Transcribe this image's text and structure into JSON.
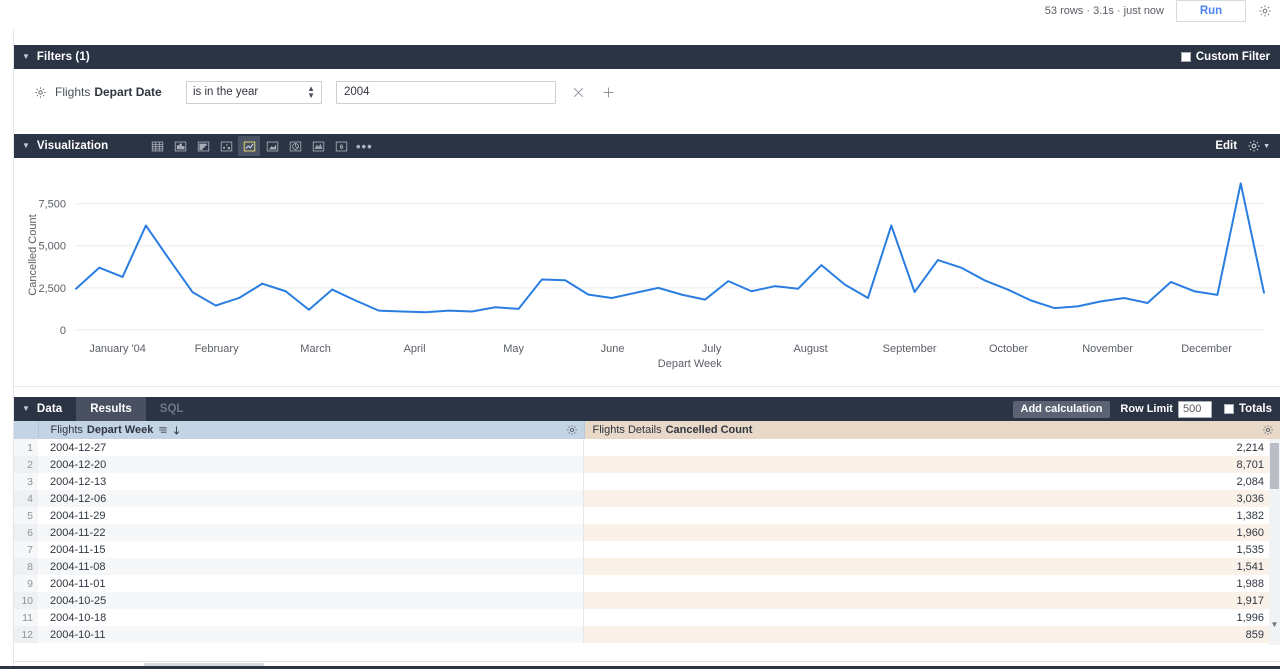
{
  "topbar": {
    "run_meta": "53 rows · 3.1s · just now",
    "run_label": "Run",
    "gear_icon": "gear-icon"
  },
  "filters": {
    "title": "Filters (1)",
    "custom_filter_label": "Custom Filter",
    "custom_filter_checked": false,
    "field_prefix": "Flights",
    "field_name": "Depart Date",
    "operator": "is in the year",
    "value": "2004",
    "remove_icon": "close-icon",
    "add_icon": "plus-icon"
  },
  "visualization": {
    "title": "Visualization",
    "edit_label": "Edit",
    "icons": [
      {
        "name": "table-chart-icon",
        "selected": false
      },
      {
        "name": "bar-chart-icon",
        "selected": false
      },
      {
        "name": "row-chart-icon",
        "selected": false
      },
      {
        "name": "scatter-chart-icon",
        "selected": false
      },
      {
        "name": "line-chart-icon",
        "selected": true
      },
      {
        "name": "area-chart-icon",
        "selected": false
      },
      {
        "name": "pie-chart-icon",
        "selected": false
      },
      {
        "name": "map-chart-icon",
        "selected": false
      },
      {
        "name": "single-value-icon",
        "selected": false,
        "label": "6"
      },
      {
        "name": "more-options-icon",
        "selected": false,
        "label": "•••"
      }
    ]
  },
  "chart_data": {
    "type": "line",
    "title": "",
    "xlabel": "Depart Week",
    "ylabel": "Cancelled Count",
    "ylim": [
      0,
      8900
    ],
    "yticks": [
      0,
      2500,
      5000,
      7500
    ],
    "ytick_labels": [
      "0",
      "2,500",
      "5,000",
      "7,500"
    ],
    "grid": true,
    "legend": "none",
    "line_color": "#2a7de1",
    "xtick_labels": [
      "January '04",
      "February",
      "March",
      "April",
      "May",
      "June",
      "July",
      "August",
      "September",
      "October",
      "November",
      "December"
    ],
    "x": [
      "2004-01-04",
      "2004-01-11",
      "2004-01-18",
      "2004-01-25",
      "2004-02-01",
      "2004-02-08",
      "2004-02-15",
      "2004-02-22",
      "2004-02-29",
      "2004-03-07",
      "2004-03-14",
      "2004-03-21",
      "2004-03-28",
      "2004-04-04",
      "2004-04-11",
      "2004-04-18",
      "2004-04-25",
      "2004-05-02",
      "2004-05-09",
      "2004-05-16",
      "2004-05-23",
      "2004-05-30",
      "2004-06-06",
      "2004-06-13",
      "2004-06-20",
      "2004-06-27",
      "2004-07-04",
      "2004-07-11",
      "2004-07-18",
      "2004-07-25",
      "2004-08-01",
      "2004-08-08",
      "2004-08-15",
      "2004-08-22",
      "2004-08-29",
      "2004-09-05",
      "2004-09-12",
      "2004-09-19",
      "2004-09-26",
      "2004-10-03",
      "2004-10-11",
      "2004-10-18",
      "2004-10-25",
      "2004-11-01",
      "2004-11-08",
      "2004-11-15",
      "2004-11-22",
      "2004-11-29",
      "2004-12-06",
      "2004-12-13",
      "2004-12-20",
      "2004-12-27"
    ],
    "values": [
      2450,
      3700,
      3150,
      6200,
      4200,
      2250,
      1450,
      1900,
      2750,
      2300,
      1200,
      2400,
      1750,
      1150,
      1100,
      1050,
      1150,
      1100,
      1350,
      1250,
      3000,
      2950,
      2100,
      1900,
      2200,
      2500,
      2100,
      1800,
      2900,
      2300,
      2600,
      2450,
      3850,
      2700,
      1900,
      6200,
      2250,
      4150,
      3700,
      2950,
      2400,
      1750,
      1300,
      1400,
      1700,
      1900,
      1600,
      2850,
      2300,
      2084,
      8701,
      2214
    ]
  },
  "data_section": {
    "title": "Data",
    "tabs": [
      {
        "label": "Results",
        "active": true
      },
      {
        "label": "SQL",
        "active": false
      }
    ],
    "add_calculation_label": "Add calculation",
    "row_limit_label": "Row Limit",
    "row_limit_value": "500",
    "totals_label": "Totals",
    "totals_checked": false,
    "columns": [
      {
        "prefix": "Flights",
        "name": "Depart Week",
        "sort_icon": "filter-icon",
        "direction_icon": "arrow-down-icon",
        "gear_icon": "gear-icon"
      },
      {
        "prefix": "Flights Details",
        "name": "Cancelled Count",
        "gear_icon": "gear-icon"
      }
    ],
    "rows": [
      {
        "n": "1",
        "date": "2004-12-27",
        "value": "2,214"
      },
      {
        "n": "2",
        "date": "2004-12-20",
        "value": "8,701"
      },
      {
        "n": "3",
        "date": "2004-12-13",
        "value": "2,084"
      },
      {
        "n": "4",
        "date": "2004-12-06",
        "value": "3,036"
      },
      {
        "n": "5",
        "date": "2004-11-29",
        "value": "1,382"
      },
      {
        "n": "6",
        "date": "2004-11-22",
        "value": "1,960"
      },
      {
        "n": "7",
        "date": "2004-11-15",
        "value": "1,535"
      },
      {
        "n": "8",
        "date": "2004-11-08",
        "value": "1,541"
      },
      {
        "n": "9",
        "date": "2004-11-01",
        "value": "1,988"
      },
      {
        "n": "10",
        "date": "2004-10-25",
        "value": "1,917"
      },
      {
        "n": "11",
        "date": "2004-10-18",
        "value": "1,996"
      },
      {
        "n": "12",
        "date": "2004-10-11",
        "value": "859"
      }
    ]
  }
}
